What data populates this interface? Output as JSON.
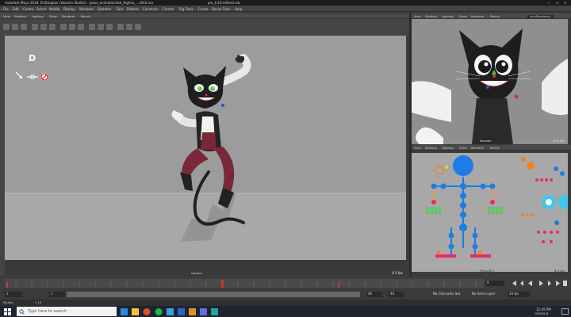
{
  "window": {
    "title": "Autodesk Maya 2018: D:\\Dropbox (Vaseum Studio)\\...\\pose_animation3ed_Rig\\ma_...v010.ma",
    "status_text": "pre_1/10-refine3.mb"
  },
  "menubar": [
    "File",
    "Edit",
    "Create",
    "Select",
    "Modify",
    "Display",
    "Windows",
    "Skeleton",
    "Skin",
    "Deform",
    "Constrain",
    "Control",
    "Rig Tools",
    "Cache",
    "Bonus Tools",
    "Help"
  ],
  "main_panel_menu": [
    "View",
    "Shading",
    "Lighting",
    "Show",
    "Renderer",
    "Panels"
  ],
  "main_viewport": {
    "hud_letter": "D",
    "camera_label": "camera",
    "fps": "6.5 fps"
  },
  "top_right_panel": {
    "menu": [
      "View",
      "Shading",
      "Lighting",
      "Show",
      "Renderer",
      "Panels"
    ],
    "camera_label": "facecam",
    "fps": "10.5 fps",
    "dropdown": "facePanelsets1"
  },
  "bottom_right_panel": {
    "menu": [
      "View",
      "Shading",
      "Lighting",
      "Show",
      "Renderer",
      "Panels"
    ],
    "camera_label": "Persp/rig_1",
    "fps": "6.4 fps"
  },
  "timeline": {
    "current_frame": "9",
    "start": "1",
    "end": "40",
    "range_start": "1",
    "range_end": "40",
    "character_set": "No Character Set",
    "anim_layer": "No Anim Layer",
    "fps_setting": "24 fps"
  },
  "cmdline": {
    "label": "Python",
    "result": "1 10"
  },
  "taskbar": {
    "search_placeholder": "Type here to search",
    "time": "12:45 PM",
    "date": "10/9/2018"
  },
  "colors": {
    "viewport_bg": "#9c9c9c",
    "ui_dark": "#444444",
    "playhead": "#c83838",
    "rig_blue": "#1e7ce6",
    "rig_orange": "#f08020",
    "rig_green": "#5cc85c",
    "rig_pink": "#e82a6c",
    "rig_cyan": "#40c8e8"
  }
}
